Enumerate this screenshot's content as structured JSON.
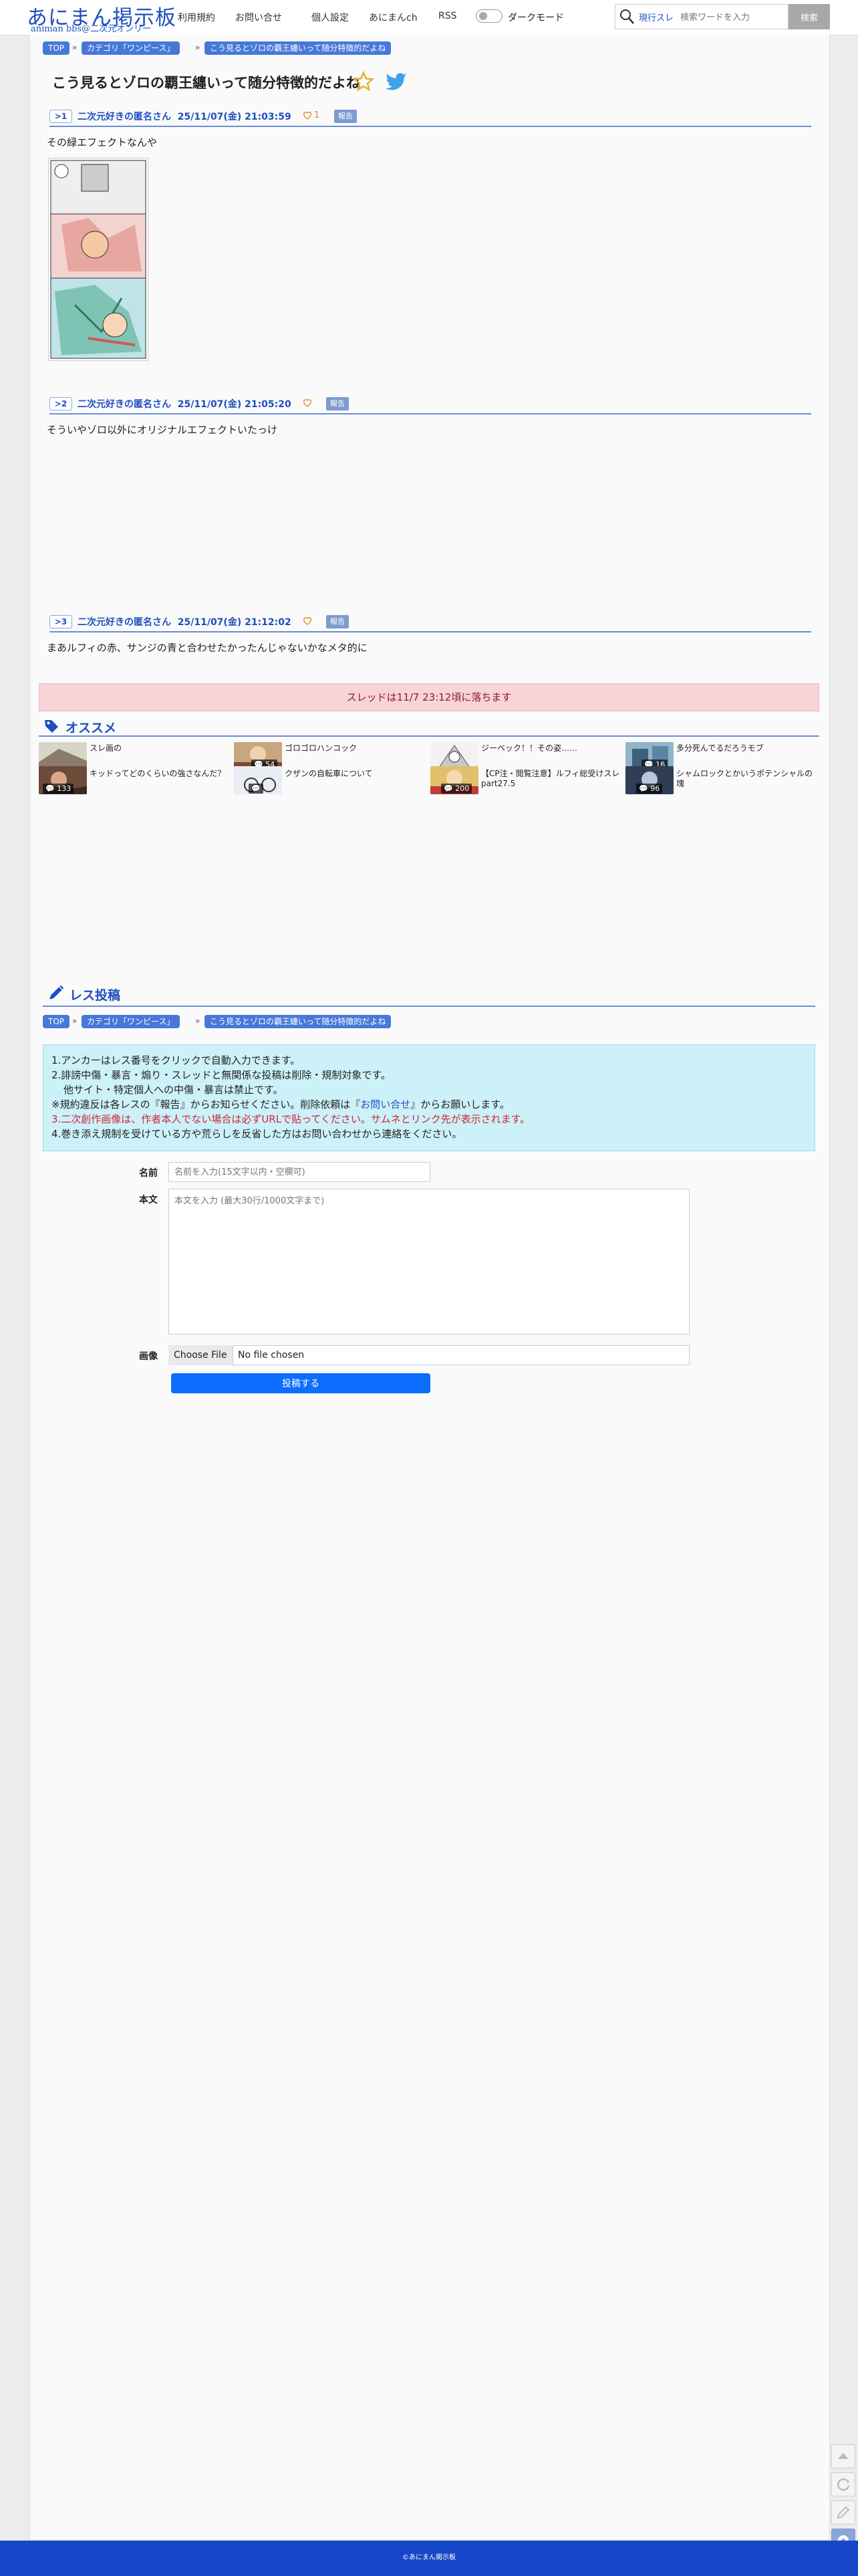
{
  "header": {
    "logo_main": "あにまん掲示板",
    "logo_sub": "animan bbs@二次元オンリー",
    "nav": [
      "利用規約",
      "お問い合せ",
      "個人設定",
      "あにまんch",
      "RSS"
    ],
    "dark_mode_label": "ダークモード",
    "search_scope": "現行スレ",
    "search_placeholder": "検索ワードを入力",
    "search_button": "検索"
  },
  "breadcrumbs": [
    "TOP",
    "カテゴリ「ワンピース」",
    "こう見るとゾロの覇王纏いって随分特徴的だよね"
  ],
  "breadcrumb_sep": "»",
  "thread_title": "こう見るとゾロの覇王纏いって随分特徴的だよね",
  "posts": [
    {
      "no": ">1",
      "name": "二次元好きの匿名さん",
      "date": "25/11/07(金) 21:03:59",
      "likes": "1",
      "report": "報告",
      "body": "その緑エフェクトなんや"
    },
    {
      "no": ">2",
      "name": "二次元好きの匿名さん",
      "date": "25/11/07(金) 21:05:20",
      "likes": "",
      "report": "報告",
      "body": "そういやゾロ以外にオリジナルエフェクトいたっけ"
    },
    {
      "no": ">3",
      "name": "二次元好きの匿名さん",
      "date": "25/11/07(金) 21:12:02",
      "likes": "",
      "report": "報告",
      "body": "まあルフィの赤、サンジの青と合わせたかったんじゃないかなメタ的に"
    }
  ],
  "status_message": "スレッドは11/7 23:12頃に落ちます",
  "recommend": {
    "title": "オススメ",
    "items": [
      {
        "title": "スレ画の",
        "count": ""
      },
      {
        "title": "ゴロゴロハンコック",
        "count": "54"
      },
      {
        "title": "ジーベック！！その姿……",
        "count": ""
      },
      {
        "title": "多分死んでるだろうモブ",
        "count": "16"
      },
      {
        "title": "キッドってどのくらいの強さなんだ？",
        "count": "133"
      },
      {
        "title": "クザンの自転車について",
        "count": ""
      },
      {
        "title": "【CP注・閲覧注意】ルフィ総受けスレpart27.5",
        "count": "200"
      },
      {
        "title": "シャムロックとかいうポテンシャルの塊",
        "count": "96"
      }
    ]
  },
  "reply": {
    "title": "レス投稿",
    "rules": [
      "1.アンカーはレス番号をクリックで自動入力できます。",
      "2.誹謗中傷・暴言・煽り・スレッドと無関係な投稿は削除・規制対象です。",
      "他サイト・特定個人への中傷・暴言は禁止です。",
      "※規約違反は各レスの『報告』からお知らせください。削除依頼は『",
      "お問い合せ",
      "』からお願いします。",
      "3.二次創作画像は、作者本人でない場合は必ずURLで貼ってください。サムネとリンク先が表示されます。",
      "4.巻き添え規制を受けている方や荒らしを反省した方はお問い合わせから連絡をください。"
    ],
    "name_label": "名前",
    "name_placeholder": "名前を入力(15文字以内・空欄可)",
    "body_label": "本文",
    "body_placeholder": "本文を入力 (最大30行/1000文字まで)",
    "image_label": "画像",
    "file_button": "Choose File",
    "file_status": "No file chosen",
    "submit": "投稿する"
  },
  "footer": {
    "copyright": "©あにまん掲示板"
  },
  "colors": {
    "accent": "#1e4fbf",
    "footer": "#1647c8",
    "rules_bg": "#cdf1f8",
    "status_bg": "#f8d3d8",
    "submit": "#0b6efd"
  }
}
